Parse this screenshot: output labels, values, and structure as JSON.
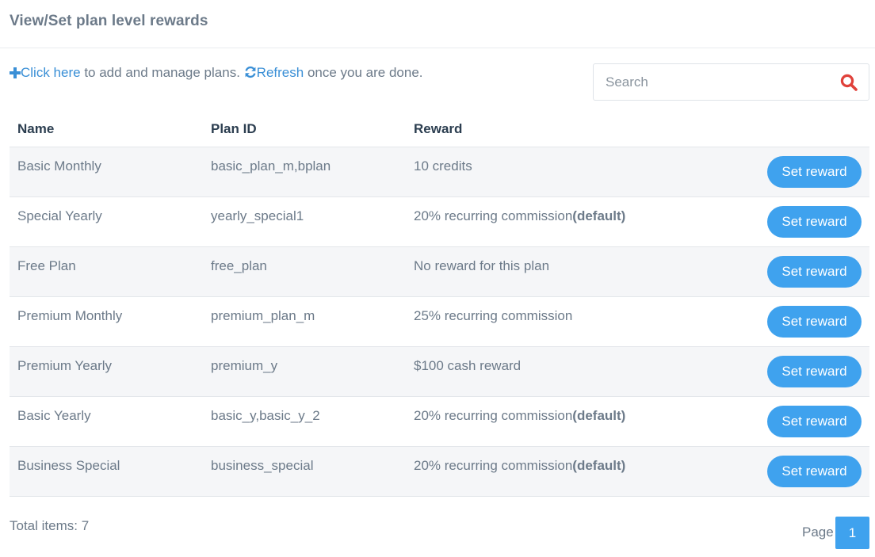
{
  "header": {
    "title": "View/Set plan level rewards"
  },
  "info": {
    "click_here": "Click here",
    "manage_text": "to add and manage plans.",
    "refresh": "Refresh",
    "done_text": "once you are done."
  },
  "search": {
    "placeholder": "Search",
    "value": ""
  },
  "table": {
    "columns": [
      "Name",
      "Plan ID",
      "Reward"
    ],
    "rows": [
      {
        "name": "Basic Monthly",
        "plan_id": "basic_plan_m,bplan",
        "reward": "10 credits",
        "default": "",
        "action": "Set reward"
      },
      {
        "name": "Special Yearly",
        "plan_id": "yearly_special1",
        "reward": "20% recurring commission",
        "default": "(default)",
        "action": "Set reward"
      },
      {
        "name": "Free Plan",
        "plan_id": "free_plan",
        "reward": "No reward for this plan",
        "default": "",
        "action": "Set reward"
      },
      {
        "name": "Premium Monthly",
        "plan_id": "premium_plan_m",
        "reward": "25% recurring commission",
        "default": "",
        "action": "Set reward"
      },
      {
        "name": "Premium Yearly",
        "plan_id": "premium_y",
        "reward": "$100 cash reward",
        "default": "",
        "action": "Set reward"
      },
      {
        "name": "Basic Yearly",
        "plan_id": "basic_y,basic_y_2",
        "reward": "20% recurring commission",
        "default": "(default)",
        "action": "Set reward"
      },
      {
        "name": "Business Special",
        "plan_id": "business_special",
        "reward": "20% recurring commission",
        "default": "(default)",
        "action": "Set reward"
      }
    ]
  },
  "footer": {
    "total": "Total items: 7",
    "page_label": "Page",
    "current_page": "1"
  },
  "colors": {
    "accent": "#3fa2ee",
    "link": "#3a8fd6",
    "search_icon": "#e0413a",
    "row_alt": "#f5f6f8"
  },
  "icons": {
    "add": "plus-icon",
    "refresh": "refresh-icon",
    "search": "search-icon"
  }
}
